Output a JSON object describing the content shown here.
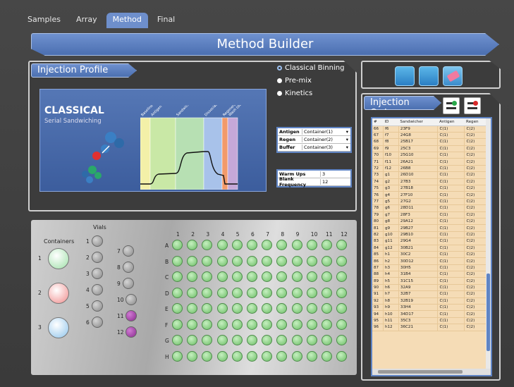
{
  "tabs": [
    "Samples",
    "Array",
    "Method",
    "Final"
  ],
  "active_tab": "Method",
  "title": "Method Builder",
  "profile": {
    "header": "Injection Profile",
    "options": [
      "Classical Binning",
      "Pre-mix",
      "Kinetics"
    ],
    "selected": "Classical Binning",
    "diagram_title": "CLASSICAL",
    "diagram_subtitle": "Serial Sandwiching",
    "phases": [
      "Baseline (dh)",
      "Antigen",
      "Sandwicher",
      "Dissociation",
      "Regeneration",
      "Wash (db)"
    ],
    "form": [
      {
        "label": "Antigen",
        "value": "Container(1)"
      },
      {
        "label": "Regen",
        "value": "Container(2)"
      },
      {
        "label": "Buffer",
        "value": "Container(3)"
      }
    ],
    "settings": [
      {
        "label": "Warm Ups",
        "value": "3"
      },
      {
        "label": "Blank Frequency",
        "value": "12"
      }
    ]
  },
  "order": {
    "header": "Injection Order",
    "columns": [
      "#",
      "ID",
      "Sandwicher",
      "Antigen",
      "Regen"
    ],
    "rows": [
      [
        "66",
        "f6",
        "23F9",
        "C(1)",
        "C(2)"
      ],
      [
        "67",
        "f7",
        "24G8",
        "C(1)",
        "C(2)"
      ],
      [
        "68",
        "f8",
        "25B17",
        "C(1)",
        "C(2)"
      ],
      [
        "69",
        "f9",
        "25C3",
        "C(1)",
        "C(2)"
      ],
      [
        "70",
        "f10",
        "25G10",
        "C(1)",
        "C(2)"
      ],
      [
        "71",
        "f11",
        "26A21",
        "C(1)",
        "C(2)"
      ],
      [
        "72",
        "f12",
        "26B8",
        "C(1)",
        "C(2)"
      ],
      [
        "73",
        "g1",
        "26D10",
        "C(1)",
        "C(2)"
      ],
      [
        "74",
        "g2",
        "27B3",
        "C(1)",
        "C(2)"
      ],
      [
        "75",
        "g3",
        "27B18",
        "C(1)",
        "C(2)"
      ],
      [
        "76",
        "g4",
        "27F10",
        "C(1)",
        "C(2)"
      ],
      [
        "77",
        "g5",
        "27G2",
        "C(1)",
        "C(2)"
      ],
      [
        "78",
        "g6",
        "28D11",
        "C(1)",
        "C(2)"
      ],
      [
        "79",
        "g7",
        "28F3",
        "C(1)",
        "C(2)"
      ],
      [
        "80",
        "g8",
        "29A12",
        "C(1)",
        "C(2)"
      ],
      [
        "81",
        "g9",
        "29B27",
        "C(1)",
        "C(2)"
      ],
      [
        "82",
        "g10",
        "29B10",
        "C(1)",
        "C(2)"
      ],
      [
        "83",
        "g11",
        "29G4",
        "C(1)",
        "C(2)"
      ],
      [
        "84",
        "g12",
        "30B21",
        "C(1)",
        "C(2)"
      ],
      [
        "85",
        "h1",
        "30C2",
        "C(1)",
        "C(2)"
      ],
      [
        "86",
        "h2",
        "30D12",
        "C(1)",
        "C(2)"
      ],
      [
        "87",
        "h3",
        "30H5",
        "C(1)",
        "C(2)"
      ],
      [
        "88",
        "h4",
        "31B4",
        "C(1)",
        "C(2)"
      ],
      [
        "89",
        "h5",
        "31C15",
        "C(1)",
        "C(2)"
      ],
      [
        "90",
        "h6",
        "32A9",
        "C(1)",
        "C(2)"
      ],
      [
        "91",
        "h7",
        "32B7",
        "C(1)",
        "C(2)"
      ],
      [
        "92",
        "h8",
        "32B19",
        "C(1)",
        "C(2)"
      ],
      [
        "93",
        "h9",
        "33H4",
        "C(1)",
        "C(2)"
      ],
      [
        "94",
        "h10",
        "34D17",
        "C(1)",
        "C(2)"
      ],
      [
        "95",
        "h11",
        "35C3",
        "C(1)",
        "C(2)"
      ],
      [
        "96",
        "h12",
        "36C21",
        "C(1)",
        "C(2)"
      ]
    ]
  },
  "plate": {
    "containers_label": "Containers",
    "vials_label": "Vials",
    "containers": [
      "1",
      "2",
      "3"
    ],
    "vials": [
      "1",
      "2",
      "3",
      "4",
      "5",
      "6",
      "7",
      "8",
      "9",
      "10",
      "11",
      "12"
    ],
    "cols": [
      "1",
      "2",
      "3",
      "4",
      "5",
      "6",
      "7",
      "8",
      "9",
      "10",
      "11",
      "12"
    ],
    "rows": [
      "A",
      "B",
      "C",
      "D",
      "E",
      "F",
      "G",
      "H"
    ]
  },
  "colors": {
    "accent": "#5f84c4",
    "well": "#7fc87a",
    "vial_purple": "#9b3aa0",
    "container1": "#9fe0a8",
    "container2": "#f08c8c",
    "container3": "#8fc4ec"
  }
}
